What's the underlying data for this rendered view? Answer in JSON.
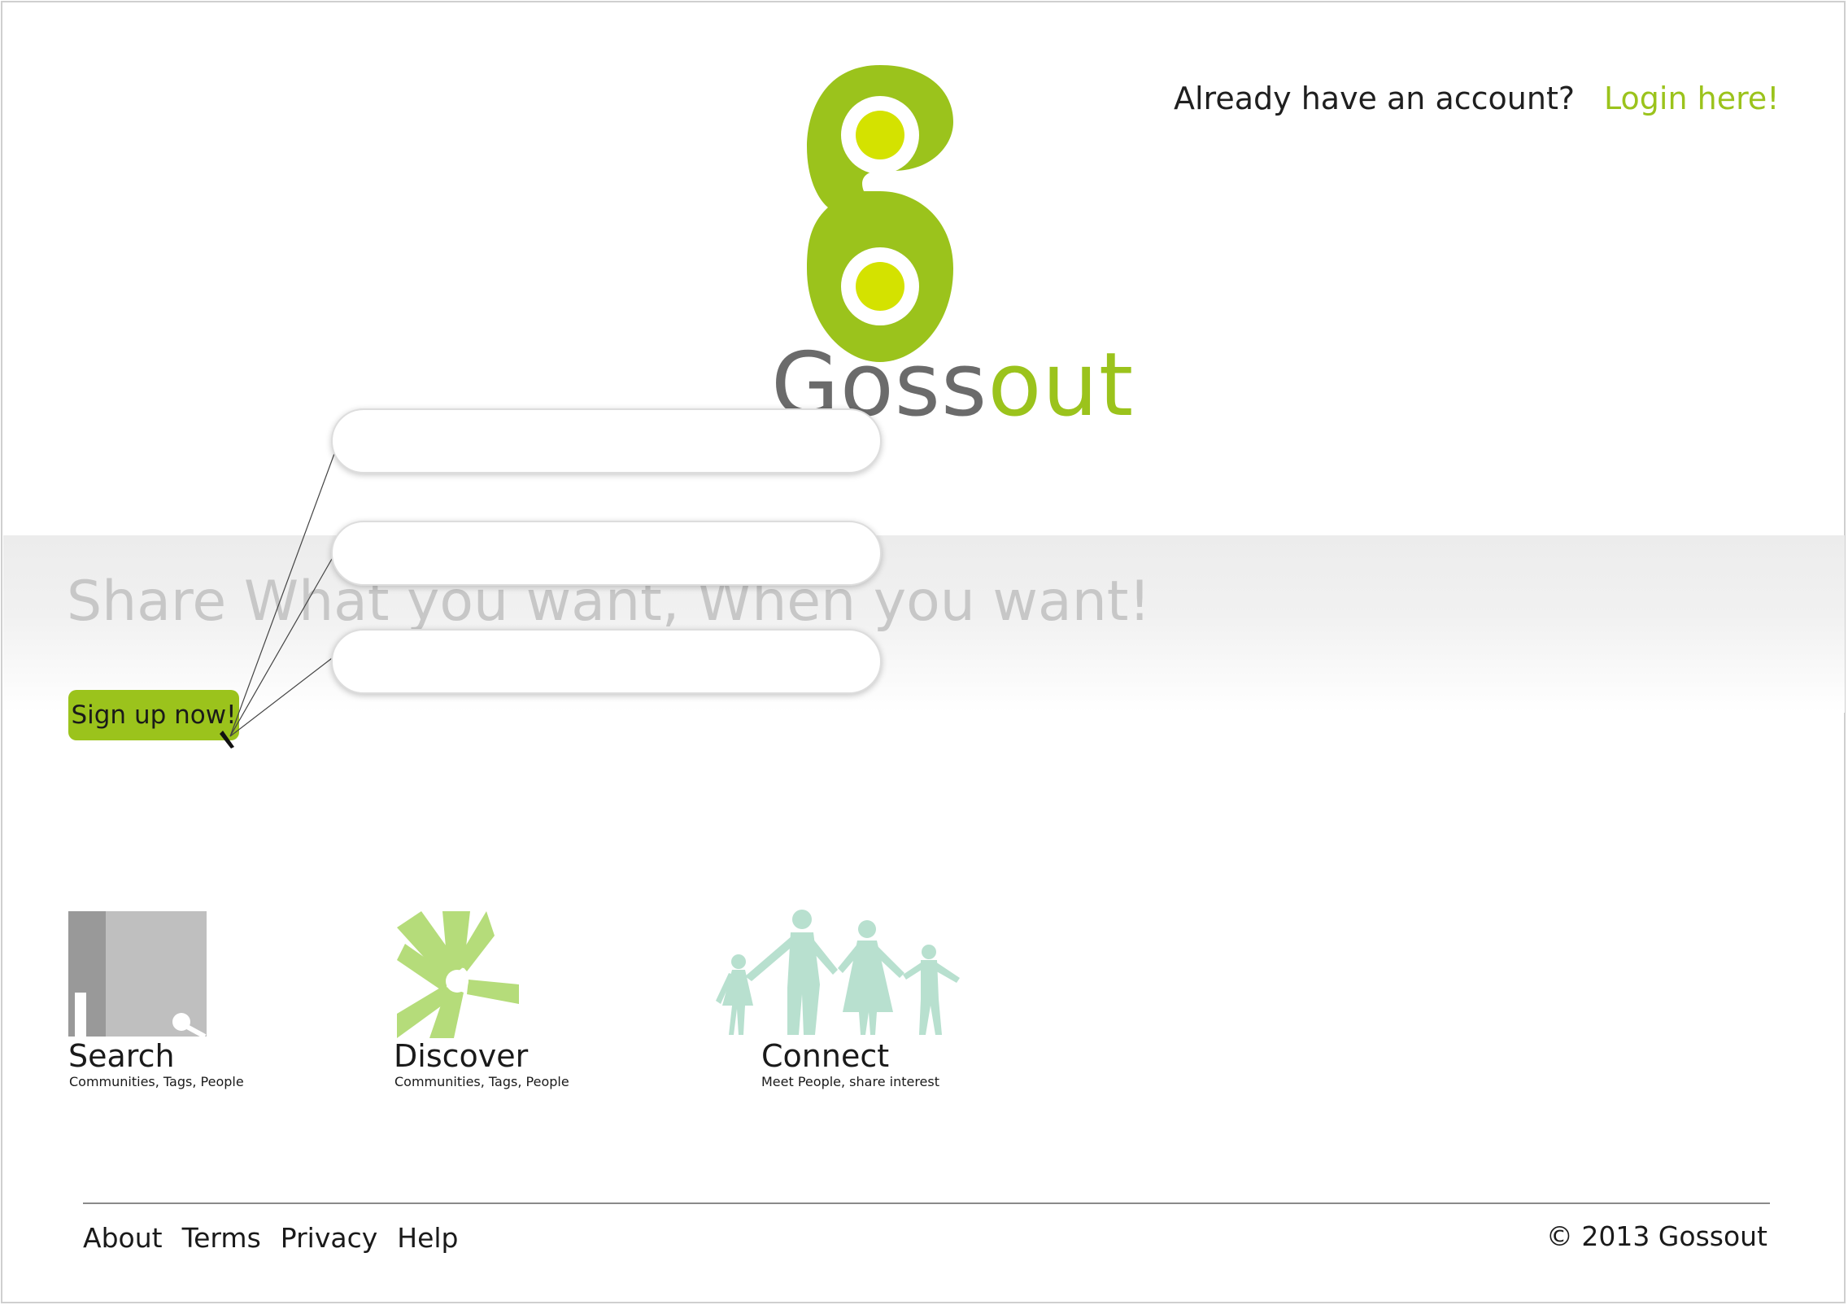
{
  "header": {
    "login_prompt": "Already have an account?",
    "login_link": "Login here!"
  },
  "brand": {
    "name_part1": "Goss",
    "name_part2": "out",
    "primary_color": "#9bc31c",
    "accent_color": "#d4e200",
    "gray_color": "#6b6b6b"
  },
  "hero": {
    "tagline": "Share What you want, When you want!",
    "signup_label": "Sign up now!"
  },
  "signup_form": {
    "fields": [
      {
        "value": "",
        "placeholder": ""
      },
      {
        "value": "",
        "placeholder": ""
      },
      {
        "value": "",
        "placeholder": ""
      }
    ]
  },
  "features": [
    {
      "title": "Search",
      "subtitle": "Communities, Tags, People",
      "icon": "search-icon"
    },
    {
      "title": "Discover",
      "subtitle": "Communities, Tags, People",
      "icon": "hands-icon"
    },
    {
      "title": "Connect",
      "subtitle": "Meet People, share interest",
      "icon": "family-icon"
    }
  ],
  "footer": {
    "links": [
      "About",
      "Terms",
      "Privacy",
      "Help"
    ],
    "copyright": "© 2013 Gossout"
  }
}
